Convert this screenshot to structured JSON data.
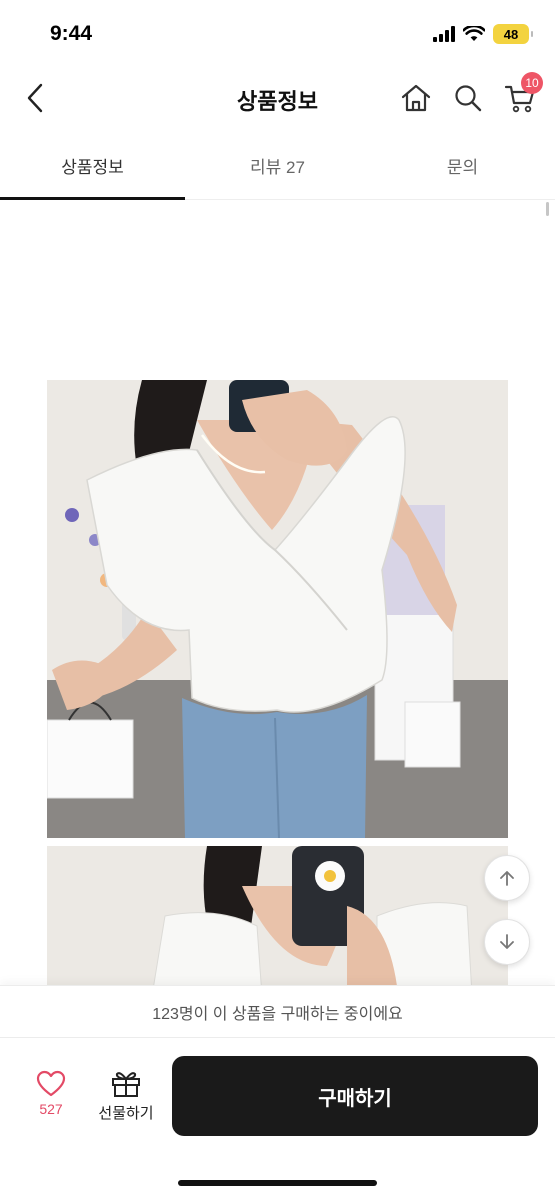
{
  "status": {
    "time": "9:44",
    "battery": "48"
  },
  "header": {
    "title": "상품정보",
    "cart_count": "10",
    "icons": [
      "back-icon",
      "home-icon",
      "search-icon",
      "cart-icon"
    ]
  },
  "tabs": [
    {
      "label": "상품정보",
      "active": true
    },
    {
      "label": "리뷰 27",
      "active": false
    },
    {
      "label": "문의",
      "active": false
    }
  ],
  "product_photos": [
    {
      "alt": "white ruffle-sleeve wrap blouse mirror selfie with jeans"
    },
    {
      "alt": "white ruffle-sleeve blouse mirror selfie, second view"
    }
  ],
  "notice": {
    "text": "123명이 이 상품을 구매하는 중이에요"
  },
  "bottom_bar": {
    "like_count": "527",
    "gift_label": "선물하기",
    "buy_label": "구매하기"
  },
  "colors": {
    "accent_red": "#e34a66",
    "badge": "#ee5566",
    "buy_button": "#1a1a1a",
    "battery": "#f3d33f"
  }
}
